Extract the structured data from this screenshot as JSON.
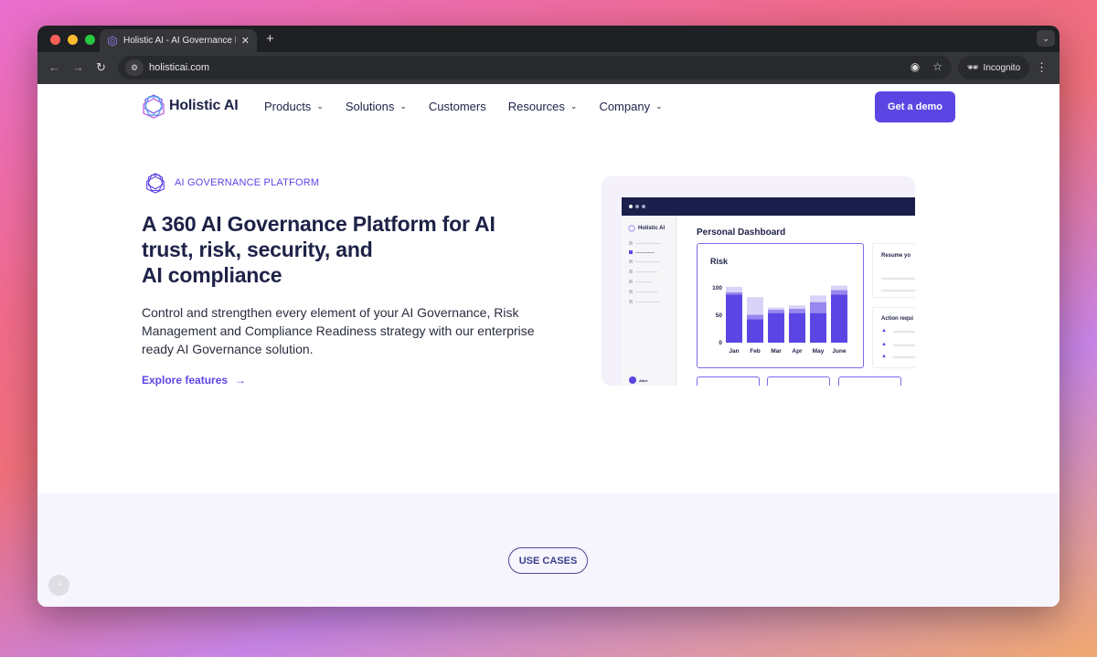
{
  "browser": {
    "tab_title": "Holistic AI - AI Governance Pl",
    "tab_close": "✕",
    "new_tab": "+",
    "url": "holisticai.com",
    "incognito_label": "Incognito"
  },
  "nav": {
    "logo_text": "Holistic AI",
    "menu": [
      {
        "label": "Products",
        "has_dropdown": true
      },
      {
        "label": "Solutions",
        "has_dropdown": true
      },
      {
        "label": "Customers",
        "has_dropdown": false
      },
      {
        "label": "Resources",
        "has_dropdown": true
      },
      {
        "label": "Company",
        "has_dropdown": true
      }
    ],
    "cta_label": "Get a demo"
  },
  "hero": {
    "eyebrow": "AI GOVERNANCE PLATFORM",
    "headline_line1": "A 360 AI Governance Platform for AI",
    "headline_line2": "trust, risk, security, and",
    "headline_line3": "AI compliance",
    "lead": "Control and strengthen every element of your AI Governance, Risk Management and Compliance Readiness strategy with our enterprise ready AI Governance solution.",
    "link_label": "Explore features",
    "link_arrow": "→"
  },
  "dashboard": {
    "logo_text": "Holistic AI",
    "title": "Personal Dashboard",
    "user_label": "Alice",
    "risk_card_title": "Risk",
    "side_card_1": "Resume yo",
    "side_card_2": "Action requi"
  },
  "chart_data": {
    "type": "bar",
    "title": "Risk",
    "categories": [
      "Jan",
      "Feb",
      "Mar",
      "Apr",
      "May",
      "June"
    ],
    "series": [
      {
        "values": [
          88,
          43,
          54,
          54,
          54,
          88
        ]
      },
      {
        "values": [
          4,
          8,
          6,
          8,
          20,
          8
        ]
      },
      {
        "values": [
          10,
          32,
          4,
          6,
          12,
          8
        ]
      }
    ],
    "yticks": [
      0,
      50,
      100
    ],
    "ylim": [
      0,
      100
    ],
    "colors": [
      "#5b46e4",
      "#9787ef",
      "#d9d3f7"
    ]
  },
  "section": {
    "usecases_label": "USE CASES"
  },
  "colors": {
    "accent": "#5b46e4",
    "ink": "#1e2247",
    "band": "#f6f4fc"
  }
}
